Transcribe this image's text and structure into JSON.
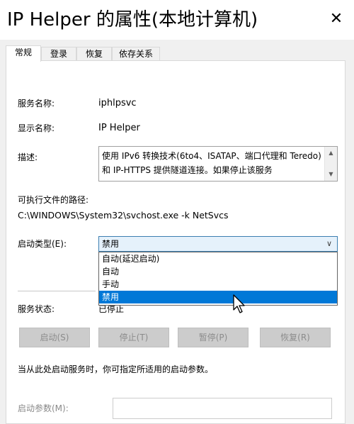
{
  "window": {
    "title": "IP Helper 的属性(本地计算机)",
    "close_glyph": "✕"
  },
  "tabs": [
    {
      "label": "常规",
      "active": true
    },
    {
      "label": "登录",
      "active": false
    },
    {
      "label": "恢复",
      "active": false
    },
    {
      "label": "依存关系",
      "active": false
    }
  ],
  "general": {
    "service_name_label": "服务名称:",
    "service_name_value": "iphlpsvc",
    "display_name_label": "显示名称:",
    "display_name_value": "IP Helper",
    "description_label": "描述:",
    "description_value": "使用 IPv6 转换技术(6to4、ISATAP、端口代理和 Teredo)和 IP-HTTPS 提供隧道连接。如果停止该服务",
    "path_label": "可执行文件的路径:",
    "path_value": "C:\\WINDOWS\\System32\\svchost.exe -k NetSvcs",
    "startup_type_label": "启动类型(E):",
    "startup_type_value": "禁用",
    "startup_options": [
      "自动(延迟启动)",
      "自动",
      "手动",
      "禁用"
    ],
    "startup_selected_index": 3,
    "status_label": "服务状态:",
    "status_value": "已停止",
    "buttons": {
      "start": "启动(S)",
      "stop": "停止(T)",
      "pause": "暂停(P)",
      "resume": "恢复(R)"
    },
    "hint": "当从此处启动服务时，你可指定所适用的启动参数。",
    "start_params_label": "启动参数(M):",
    "start_params_value": ""
  },
  "colors": {
    "selection": "#0078d7",
    "combo_focus": "#e5f1fb",
    "disabled_button": "#cccccc"
  }
}
